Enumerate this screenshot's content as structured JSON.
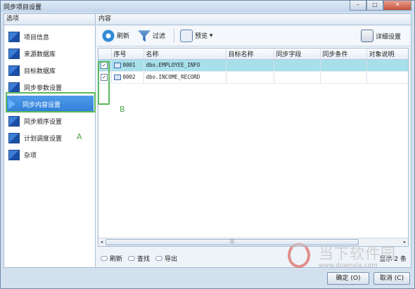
{
  "window": {
    "title": "同步项目设置",
    "min": "–",
    "max": "□",
    "close": "✕"
  },
  "left": {
    "header": "选项",
    "items": [
      "项目信息",
      "来源数据库",
      "目标数据库",
      "同步参数设置",
      "同步内容设置",
      "同步顺序设置",
      "计划调度设置",
      "杂项"
    ],
    "selected_index": 4,
    "annotation": "A"
  },
  "right": {
    "header": "内容",
    "toolbar": {
      "refresh": "刷新",
      "filter": "过滤",
      "preview": "预览",
      "preview_arrow": "▾",
      "detail": "详细设置"
    },
    "columns": [
      "",
      "序号",
      "名称",
      "目标名称",
      "同步字段",
      "同步条件",
      "对象说明"
    ],
    "rows": [
      {
        "checked": true,
        "no": "0001",
        "name": "dbo.EMPLOYEE_INFO",
        "target": "",
        "fields": "",
        "condition": "",
        "desc": "",
        "selected": true
      },
      {
        "checked": true,
        "no": "0002",
        "name": "dbo.INCOME_RECORD",
        "target": "",
        "fields": "",
        "condition": "",
        "desc": "",
        "selected": false
      }
    ],
    "check_mark": "✓",
    "annotation": "B",
    "scroll_mark": "|||",
    "bottom": {
      "refresh": "刷新",
      "find": "查找",
      "export": "导出",
      "status": "显示 2 条"
    }
  },
  "buttons": {
    "ok": "确定 (O)",
    "cancel": "取消 (C)"
  },
  "watermark": {
    "name": "当下软件园",
    "url": "www.downxia.com"
  },
  "colors": {
    "selection": "#2f7fd9",
    "row_selected": "#a7e0ea",
    "annotation": "#5cb85c"
  }
}
